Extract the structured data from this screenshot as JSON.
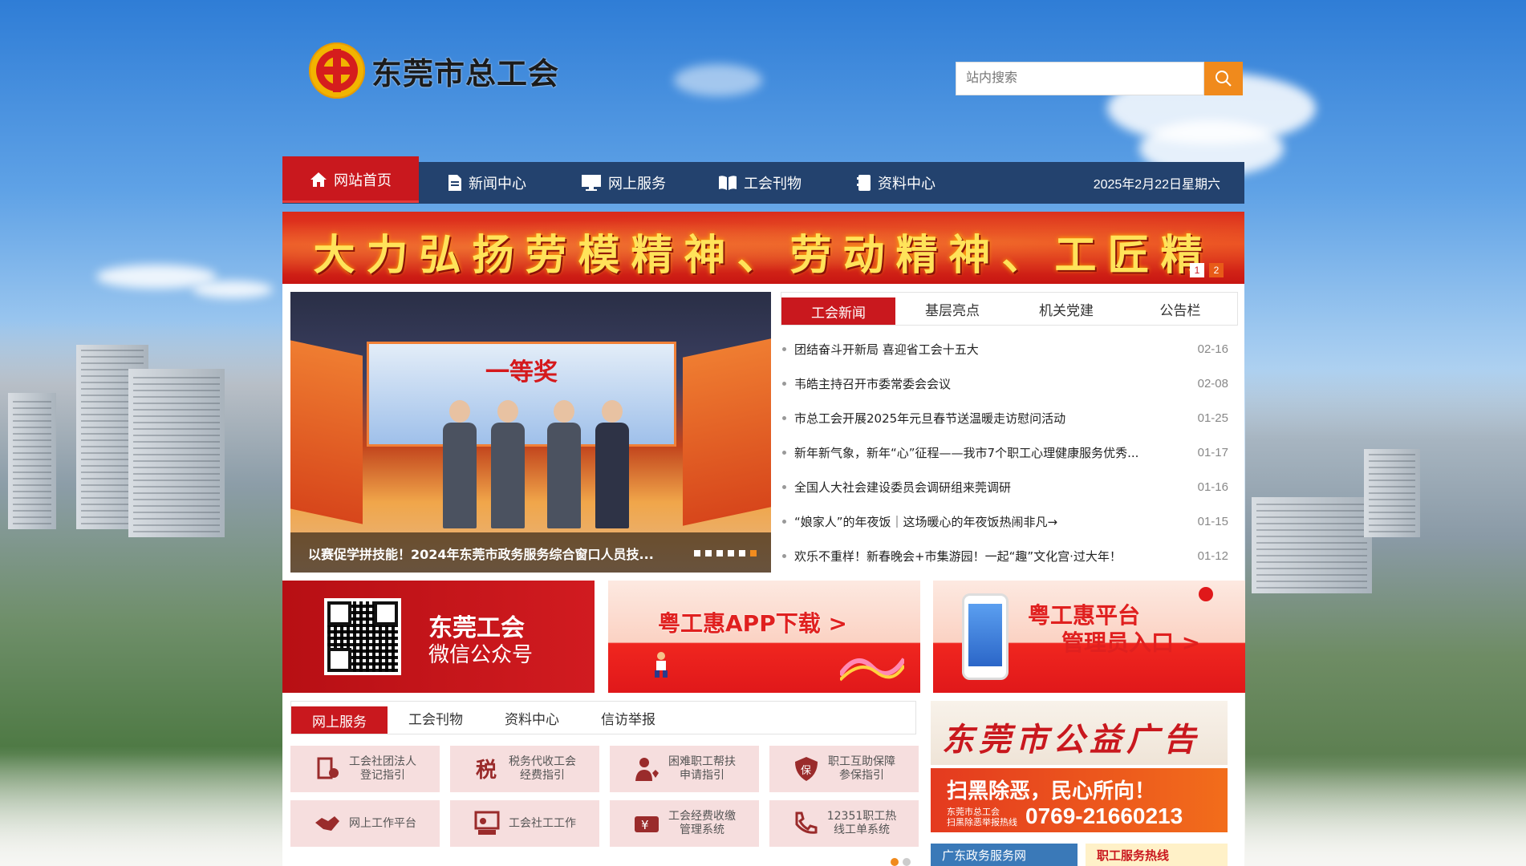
{
  "header": {
    "logo_text": "东莞市总工会",
    "search_placeholder": "站内搜索"
  },
  "nav": {
    "home": "网站首页",
    "items": [
      "新闻中心",
      "网上服务",
      "工会刊物",
      "资料中心"
    ],
    "date": "2025年2月22日星期六"
  },
  "banner": {
    "slogan": "大力弘扬劳模精神、劳动精神、工匠精神！",
    "pages": [
      "1",
      "2"
    ]
  },
  "slideshow": {
    "stage_title": "一等奖",
    "caption": "以赛促学拼技能！2024年东莞市政务服务综合窗口人员技..."
  },
  "news": {
    "tabs": [
      "工会新闻",
      "基层亮点",
      "机关党建",
      "公告栏"
    ],
    "items": [
      {
        "title": "团结奋斗开新局 喜迎省工会十五大",
        "date": "02-16"
      },
      {
        "title": "韦皓主持召开市委常委会会议",
        "date": "02-08"
      },
      {
        "title": "市总工会开展2025年元旦春节送温暖走访慰问活动",
        "date": "01-25"
      },
      {
        "title": "新年新气象，新年“心”征程——我市7个职工心理健康服务优秀...",
        "date": "01-17"
      },
      {
        "title": "全国人大社会建设委员会调研组来莞调研",
        "date": "01-16"
      },
      {
        "title": "“娘家人”的年夜饭｜这场暖心的年夜饭热闹非凡→",
        "date": "01-15"
      },
      {
        "title": "欢乐不重样！新春晚会+市集游园！一起“趣”文化宫·过大年！",
        "date": "01-12"
      }
    ]
  },
  "promos": {
    "wechat_title": "东莞工会",
    "wechat_subtitle": "微信公众号",
    "app": "粤工惠APP下载 >",
    "admin_line1": "粤工惠平台",
    "admin_line2": "管理员入口 >"
  },
  "services": {
    "tabs": [
      "网上服务",
      "工会刊物",
      "资料中心",
      "信访举报"
    ],
    "items": [
      {
        "label": "工会社团法人\n登记指引",
        "icon": "registration-icon"
      },
      {
        "label": "税务代收工会\n经费指引",
        "icon": "tax-icon"
      },
      {
        "label": "困难职工帮扶\n申请指引",
        "icon": "assistance-icon"
      },
      {
        "label": "职工互助保障\n参保指引",
        "icon": "insurance-icon"
      },
      {
        "label": "网上工作平台",
        "icon": "handshake-icon"
      },
      {
        "label": "工会社工工作",
        "icon": "social-work-icon"
      },
      {
        "label": "工会经费收缴\n管理系统",
        "icon": "fund-icon"
      },
      {
        "label": "12351职工热\n线工单系统",
        "icon": "phone-icon"
      }
    ]
  },
  "ads": {
    "public_ad": "东莞市公益广告库",
    "saohei_title": "扫黑除恶，民心所向！",
    "saohei_org": "东莞市总工会\n扫黑除恶举报热线",
    "saohei_phone": "0769-21660213",
    "gov_service": "广东政务服务网",
    "worker_hotline": "职工服务热线"
  },
  "colors": {
    "nav_bg": "#23426e",
    "accent_red": "#c9181e",
    "search_btn": "#f08a1c"
  }
}
